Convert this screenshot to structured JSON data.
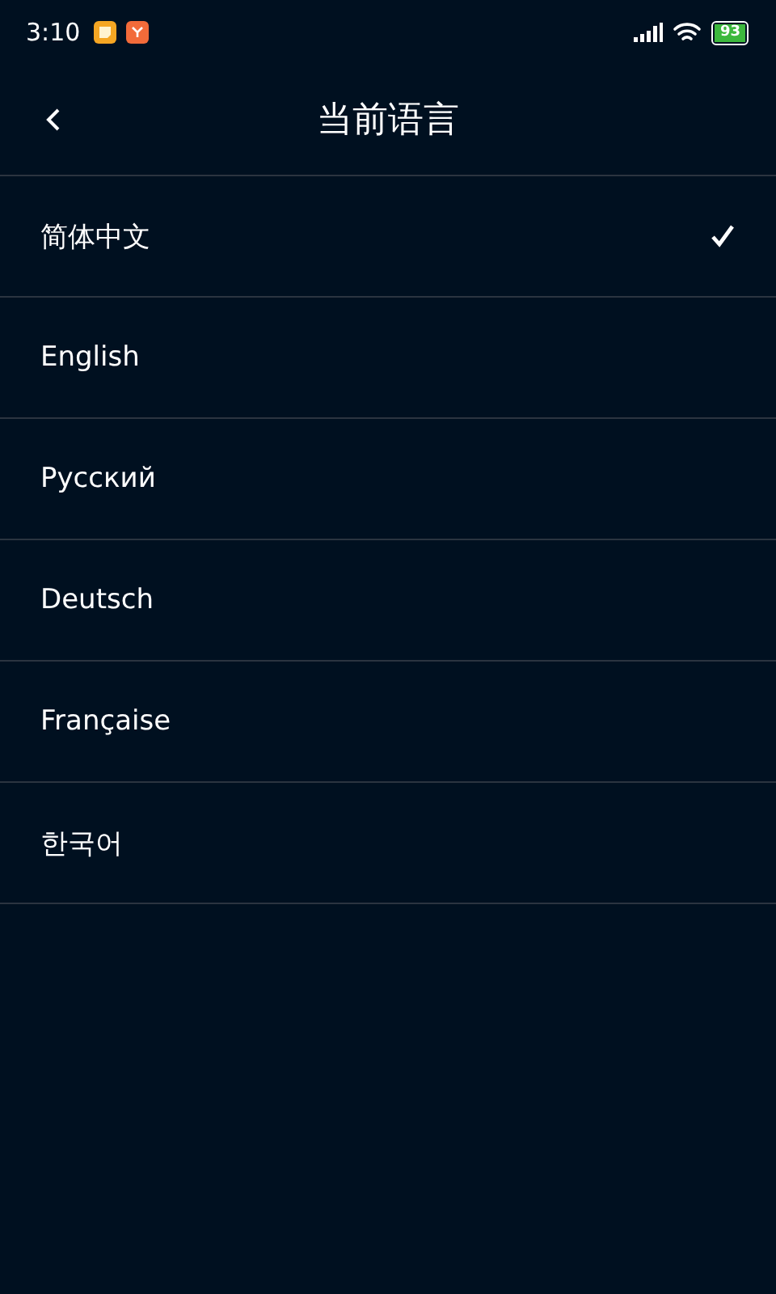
{
  "status_bar": {
    "time": "3:10",
    "battery": "93"
  },
  "header": {
    "title": "当前语言"
  },
  "languages": [
    {
      "label": "简体中文",
      "selected": true
    },
    {
      "label": "English",
      "selected": false
    },
    {
      "label": "Русский",
      "selected": false
    },
    {
      "label": "Deutsch",
      "selected": false
    },
    {
      "label": "Française",
      "selected": false
    },
    {
      "label": "한국어",
      "selected": false
    }
  ]
}
